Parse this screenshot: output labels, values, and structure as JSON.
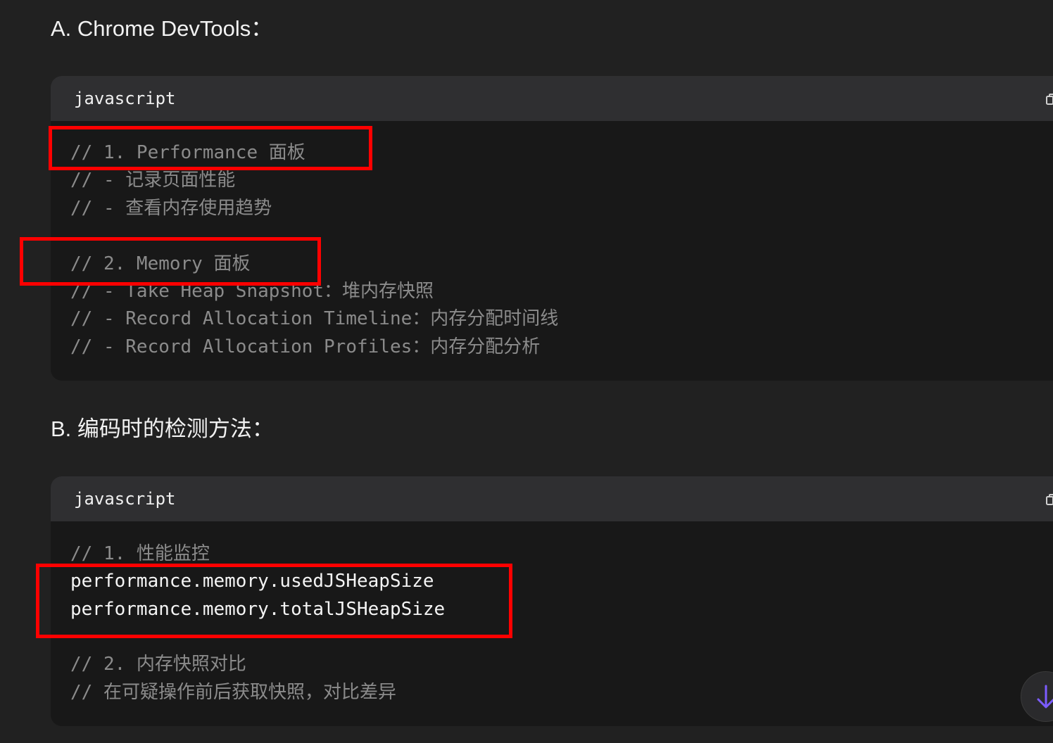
{
  "section_a": {
    "heading": "A. Chrome DevTools：",
    "code_block": {
      "language": "javascript",
      "lines": [
        "// 1. Performance 面板",
        "// - 记录页面性能",
        "// - 查看内存使用趋势",
        "",
        "// 2. Memory 面板",
        "// - Take Heap Snapshot：堆内存快照",
        "// - Record Allocation Timeline：内存分配时间线",
        "// - Record Allocation Profiles：内存分配分析"
      ]
    }
  },
  "section_b": {
    "heading": "B. 编码时的检测方法：",
    "code_block": {
      "language": "javascript",
      "lines": [
        "// 1. 性能监控",
        "performance.memory.usedJSHeapSize",
        "performance.memory.totalJSHeapSize",
        "",
        "// 2. 内存快照对比",
        "// 在可疑操作前后获取快照，对比差异"
      ]
    }
  },
  "icons": {
    "copy": "copy-icon",
    "scroll_down": "arrow-down-icon"
  },
  "colors": {
    "background": "#212121",
    "code_background": "#181818",
    "code_header": "#2f2f31",
    "comment": "#8b8b8b",
    "code_text": "#f4f4f4",
    "annotation": "#ff0000",
    "scroll_arrow": "#7c5cff"
  }
}
